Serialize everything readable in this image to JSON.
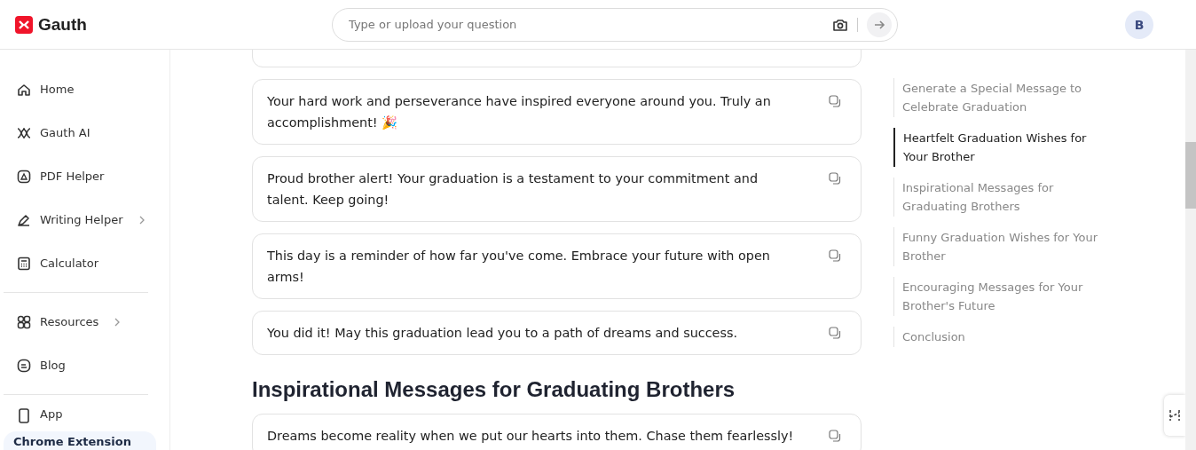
{
  "header": {
    "brand": "Gauth",
    "search": {
      "placeholder": "Type or upload your question"
    },
    "avatar": "B"
  },
  "sidebar": {
    "items": [
      {
        "label": "Home",
        "has_submenu": false
      },
      {
        "label": "Gauth AI",
        "has_submenu": false
      },
      {
        "label": "PDF Helper",
        "has_submenu": false
      },
      {
        "label": "Writing Helper",
        "has_submenu": true
      },
      {
        "label": "Calculator",
        "has_submenu": false
      },
      {
        "label": "Resources",
        "has_submenu": true
      },
      {
        "label": "Blog",
        "has_submenu": false
      },
      {
        "label": "App",
        "has_submenu": false
      }
    ],
    "banner": "Chrome Extension"
  },
  "content": [
    {
      "kind": "card_stub"
    },
    {
      "kind": "message",
      "text": "Your hard work and perseverance have inspired everyone around you. Truly an accomplishment! 🎉"
    },
    {
      "kind": "message",
      "text": "Proud brother alert! Your graduation is a testament to your commitment and talent. Keep going!"
    },
    {
      "kind": "message",
      "text": "This day is a reminder of how far you've come. Embrace your future with open arms!"
    },
    {
      "kind": "message",
      "text": "You did it! May this graduation lead you to a path of dreams and success."
    },
    {
      "kind": "heading",
      "text": "Inspirational Messages for Graduating Brothers"
    },
    {
      "kind": "message",
      "text": "Dreams become reality when we put our hearts into them. Chase them fearlessly!"
    }
  ],
  "toc": [
    {
      "label": "Generate a Special Message to Celebrate Graduation",
      "selected": false
    },
    {
      "label": "Heartfelt Graduation Wishes for Your Brother",
      "selected": true
    },
    {
      "label": "Inspirational Messages for Graduating Brothers",
      "selected": false
    },
    {
      "label": "Funny Graduation Wishes for Your Brother",
      "selected": false
    },
    {
      "label": "Encouraging Messages for Your Brother's Future",
      "selected": false
    },
    {
      "label": "Conclusion",
      "selected": false
    }
  ]
}
